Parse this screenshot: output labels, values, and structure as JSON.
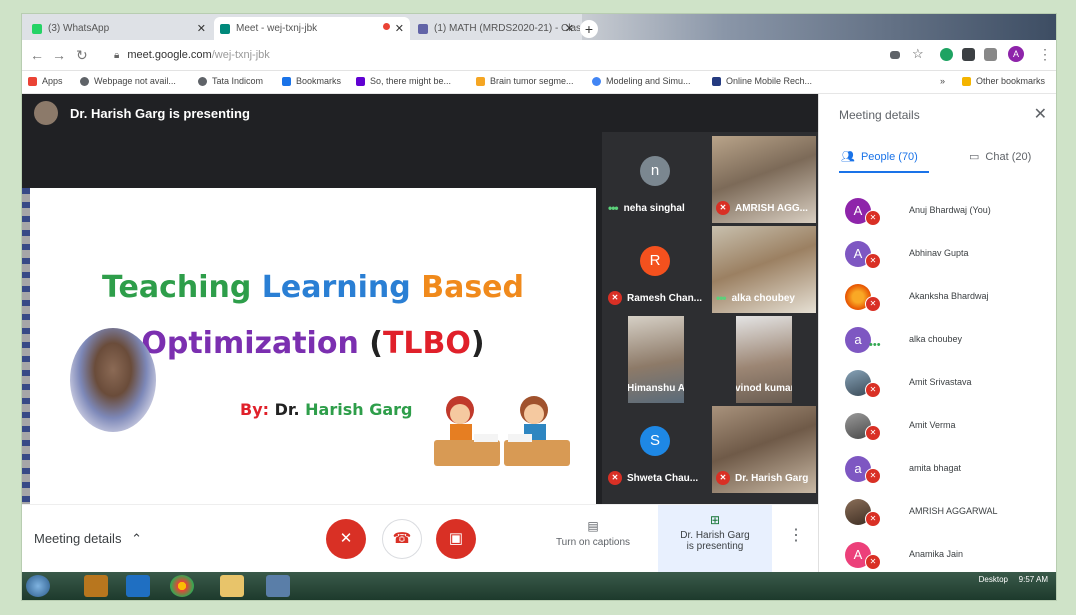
{
  "tabs": [
    {
      "title": "(3) WhatsApp",
      "active": false,
      "color": "#25d366"
    },
    {
      "title": "Meet - wej-txnj-jbk",
      "active": true,
      "color": "#00897b"
    },
    {
      "title": "(1) MATH (MRDS2020-21) - Clas",
      "active": false,
      "color": "#6264a7"
    }
  ],
  "new_tab": "+",
  "address": {
    "domain": "meet.google.com",
    "path": "/wej-txnj-jbk"
  },
  "profile_initial": "A",
  "bookmarks": [
    {
      "label": "Apps",
      "color": "#ea4335"
    },
    {
      "label": "Webpage not avail...",
      "color": "#5f6368"
    },
    {
      "label": "Tata Indicom",
      "color": "#5f6368"
    },
    {
      "label": "Bookmarks",
      "color": "#1a73e8"
    },
    {
      "label": "So, there might be...",
      "color": "#6001d2"
    },
    {
      "label": "Brain tumor segme...",
      "color": "#f5a623"
    },
    {
      "label": "Modeling and Simu...",
      "color": "#4285f4"
    },
    {
      "label": "Online Mobile Rech...",
      "color": "#253b80"
    }
  ],
  "bookmarks_more": "»",
  "other_bookmarks": "Other bookmarks",
  "presenter_title": "Dr. Harish Garg is presenting",
  "slide": {
    "line1": [
      {
        "text": "Teaching ",
        "color": "#2e9e4a"
      },
      {
        "text": "Learning ",
        "color": "#2a7fd4"
      },
      {
        "text": "Based",
        "color": "#f08a1c"
      }
    ],
    "line2": [
      {
        "text": "Optimization ",
        "color": "#7b2fb0"
      },
      {
        "text": "(",
        "color": "#222222"
      },
      {
        "text": "TLBO",
        "color": "#e0202a"
      },
      {
        "text": ")",
        "color": "#222222"
      }
    ],
    "by_label": "By:",
    "by_name_first": "Dr. ",
    "by_name_rest": "Harish Garg"
  },
  "tiles": [
    {
      "name": "neha singhal",
      "type": "letter",
      "letter": "n",
      "color": "#7b8790",
      "status": "speaking"
    },
    {
      "name": "AMRISH AGG...",
      "type": "video",
      "status": "muted"
    },
    {
      "name": "Ramesh Chan...",
      "type": "letter",
      "letter": "R",
      "color": "#f4511e",
      "status": "muted"
    },
    {
      "name": "alka choubey",
      "type": "video",
      "status": "speaking"
    },
    {
      "name": "Himanshu Ag...",
      "type": "video",
      "status": "muted"
    },
    {
      "name": "vinod kumar",
      "type": "video",
      "status": "muted"
    },
    {
      "name": "Shweta Chau...",
      "type": "letter",
      "letter": "S",
      "color": "#1e88e5",
      "status": "muted"
    },
    {
      "name": "Dr. Harish Garg",
      "type": "video",
      "status": "muted"
    }
  ],
  "toolbar": {
    "meeting_details": "Meeting details",
    "captions": "Turn on captions",
    "presenting_line1": "Dr. Harish Garg",
    "presenting_line2": "is presenting"
  },
  "panel": {
    "title": "Meeting details",
    "people_tab": "People (70)",
    "chat_tab": "Chat (20)",
    "people": [
      {
        "name": "Anuj Bhardwaj (You)",
        "initial": "A",
        "color": "#8e24aa",
        "status": "muted"
      },
      {
        "name": "Abhinav Gupta",
        "initial": "A",
        "color": "#7e57c2",
        "status": "muted"
      },
      {
        "name": "Akanksha Bhardwaj",
        "initial": "",
        "color": "#f9a825",
        "status": "muted"
      },
      {
        "name": "alka choubey",
        "initial": "a",
        "color": "#7e57c2",
        "status": "speaking"
      },
      {
        "name": "Amit Srivastava",
        "initial": "",
        "color": "#4f5b66",
        "status": "muted"
      },
      {
        "name": "Amit Verma",
        "initial": "",
        "color": "#6d6d6d",
        "status": "muted"
      },
      {
        "name": "amita bhagat",
        "initial": "a",
        "color": "#7e57c2",
        "status": "muted"
      },
      {
        "name": "AMRISH AGGARWAL",
        "initial": "",
        "color": "#5d4a3c",
        "status": "muted"
      },
      {
        "name": "Anamika Jain",
        "initial": "A",
        "color": "#ec407a",
        "status": "muted"
      }
    ]
  },
  "taskbar": {
    "desktop": "Desktop",
    "time": "9:57 AM"
  }
}
